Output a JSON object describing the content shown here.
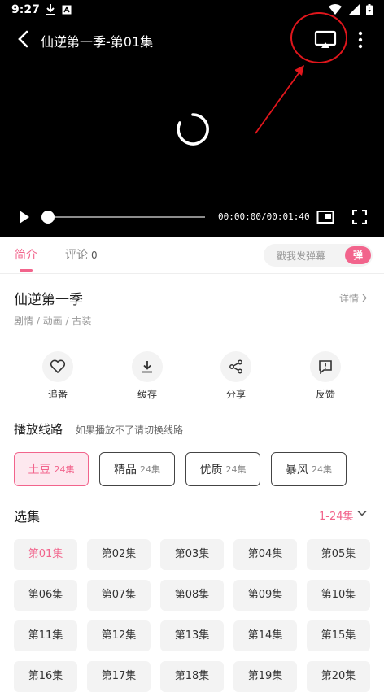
{
  "status": {
    "time": "9:27"
  },
  "player": {
    "title": "仙逆第一季-第01集",
    "current_time": "00:00:00",
    "duration": "00:01:40",
    "progress": 0.0
  },
  "tabs": {
    "intro": "简介",
    "comments": "评论",
    "comments_count": "0",
    "danmaku_placeholder": "戳我发弹幕",
    "danmaku_button": "弹"
  },
  "show": {
    "title": "仙逆第一季",
    "detail_link": "详情",
    "genres": "剧情 / 动画 / 古装"
  },
  "actions": [
    {
      "label": "追番",
      "icon": "heart-icon"
    },
    {
      "label": "缓存",
      "icon": "download-icon"
    },
    {
      "label": "分享",
      "icon": "share-icon"
    },
    {
      "label": "反馈",
      "icon": "feedback-icon"
    }
  ],
  "routes": {
    "header": "播放线路",
    "tip": "如果播放不了请切换线路",
    "items": [
      {
        "name": "土豆",
        "count": "24集",
        "active": true
      },
      {
        "name": "精品",
        "count": "24集",
        "active": false
      },
      {
        "name": "优质",
        "count": "24集",
        "active": false
      },
      {
        "name": "暴风",
        "count": "24集",
        "active": false
      }
    ]
  },
  "episodes": {
    "header": "选集",
    "range": "1-24集",
    "items": [
      "第01集",
      "第02集",
      "第03集",
      "第04集",
      "第05集",
      "第06集",
      "第07集",
      "第08集",
      "第09集",
      "第10集",
      "第11集",
      "第12集",
      "第13集",
      "第14集",
      "第15集",
      "第16集",
      "第17集",
      "第18集",
      "第19集",
      "第20集"
    ]
  },
  "colors": {
    "accent": "#f2648c",
    "annotation": "#e0161c"
  }
}
